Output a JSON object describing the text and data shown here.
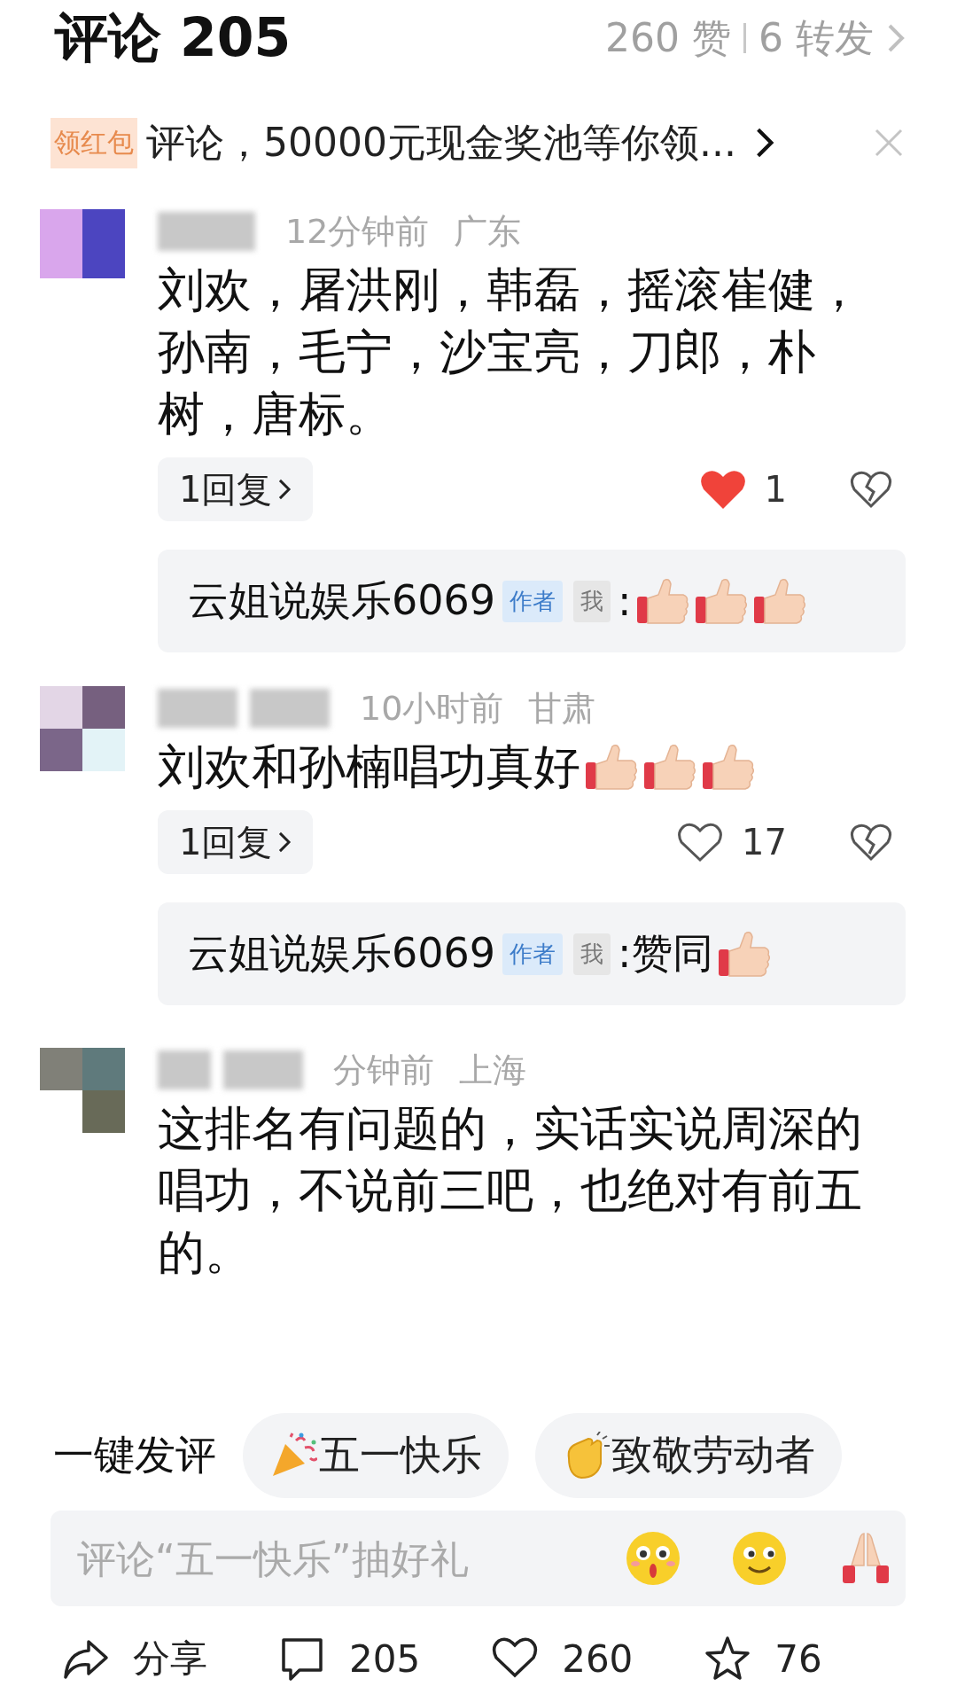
{
  "header": {
    "title": "评论 205",
    "likes": "260 赞",
    "shares": "6 转发"
  },
  "banner": {
    "badge": "领红包",
    "text": "评论，50000元现金奖池等你领..."
  },
  "comments": [
    {
      "time": "12分钟前",
      "location": "广东",
      "text": "刘欢，屠洪刚，韩磊，摇滚崔健，孙南，毛宁，沙宝亮，刀郎，朴树，唐标。",
      "replies": "1回复",
      "liked": true,
      "like_count": "1",
      "reply": {
        "author": "云姐说娱乐6069",
        "author_badge": "作者",
        "me_badge": "我",
        "text": ":",
        "emojis": [
          {
            "kind": "thumbs_up"
          },
          {
            "kind": "thumbs_up"
          },
          {
            "kind": "thumbs_up"
          }
        ]
      }
    },
    {
      "time": "10小时前",
      "location": "甘肃",
      "text": "刘欢和孙楠唱功真好",
      "emojis": [
        {
          "kind": "thumbs_up"
        },
        {
          "kind": "thumbs_up"
        },
        {
          "kind": "thumbs_up"
        }
      ],
      "replies": "1回复",
      "liked": false,
      "like_count": "17",
      "reply": {
        "author": "云姐说娱乐6069",
        "author_badge": "作者",
        "me_badge": "我",
        "text": ":赞同",
        "emojis": [
          {
            "kind": "thumbs_up"
          }
        ]
      }
    },
    {
      "time": "分钟前",
      "location": "上海",
      "text": "这排名有问题的，实话实说周深的唱功，不说前三吧，也绝对有前五的。"
    }
  ],
  "quick_comment": {
    "label": "一键发评",
    "chips": [
      {
        "kind": "party",
        "text": "五一快乐"
      },
      {
        "kind": "clap",
        "text": "致敬劳动者"
      }
    ]
  },
  "input": {
    "placeholder": "评论“五一快乐”抽好礼",
    "emojis": [
      {
        "kind": "surprised"
      },
      {
        "kind": "smile"
      },
      {
        "kind": "pray"
      }
    ]
  },
  "bottom_bar": [
    {
      "kind": "share",
      "label": "分享"
    },
    {
      "kind": "comment",
      "label": "205"
    },
    {
      "kind": "like",
      "label": "260"
    },
    {
      "kind": "star",
      "label": "76"
    }
  ]
}
